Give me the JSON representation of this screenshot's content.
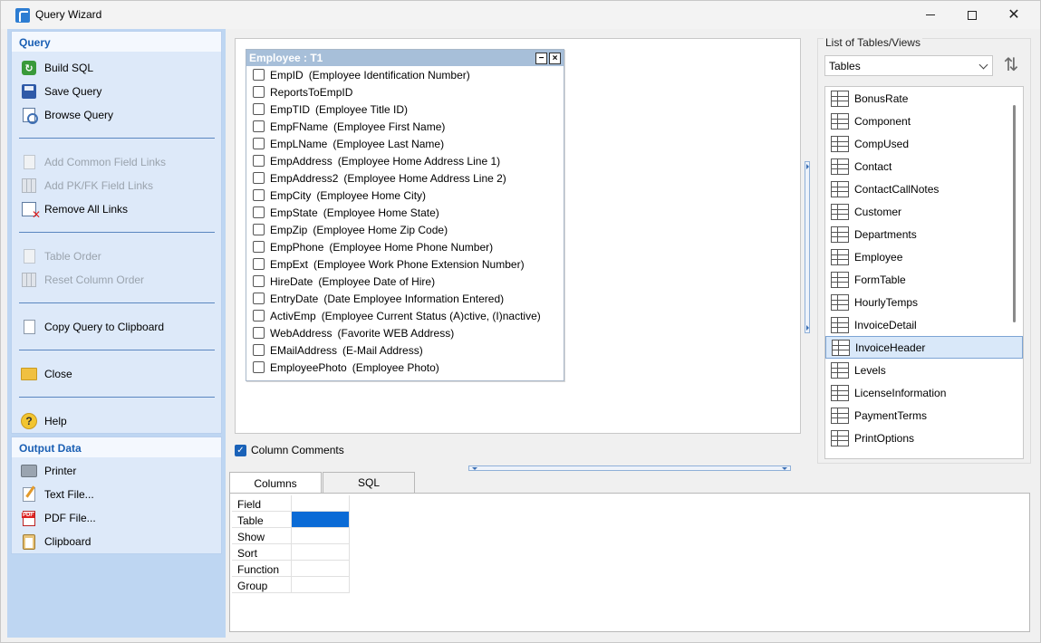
{
  "window": {
    "title": "Query Wizard",
    "minimize_glyph": "—",
    "maximize_glyph": "□",
    "close_glyph": "✕"
  },
  "left_panel": {
    "query_group": {
      "header": "Query",
      "items": [
        {
          "label": "Build SQL",
          "icon": "build-sql-icon",
          "enabled": true
        },
        {
          "label": "Save Query",
          "icon": "save-disk-icon",
          "enabled": true
        },
        {
          "label": "Browse Query",
          "icon": "browse-magnifier-icon",
          "enabled": true
        },
        {
          "label": "Add Common Field Links",
          "icon": "field-links-icon",
          "enabled": false
        },
        {
          "label": "Add PK/FK Field Links",
          "icon": "pk-fk-links-icon",
          "enabled": false
        },
        {
          "label": "Remove All Links",
          "icon": "remove-links-icon",
          "enabled": true
        },
        {
          "label": "Table Order",
          "icon": "table-order-icon",
          "enabled": false
        },
        {
          "label": "Reset Column Order",
          "icon": "reset-columns-icon",
          "enabled": false
        },
        {
          "label": "Copy Query to Clipboard",
          "icon": "copy-doc-icon",
          "enabled": true
        },
        {
          "label": "Close",
          "icon": "folder-icon",
          "enabled": true
        },
        {
          "label": "Help",
          "icon": "help-icon",
          "enabled": true
        }
      ]
    },
    "output_group": {
      "header": "Output Data",
      "items": [
        {
          "label": "Printer",
          "icon": "printer-icon"
        },
        {
          "label": "Text File...",
          "icon": "text-file-icon"
        },
        {
          "label": "PDF File...",
          "icon": "pdf-icon"
        },
        {
          "label": "Clipboard",
          "icon": "clipboard-icon"
        }
      ]
    }
  },
  "table_box": {
    "title": "Employee : T1",
    "minimize_glyph": "−",
    "close_glyph": "×",
    "fields": [
      {
        "name": "EmpID",
        "desc": "(Employee Identification Number)"
      },
      {
        "name": "ReportsToEmpID",
        "desc": ""
      },
      {
        "name": "EmpTID",
        "desc": "(Employee Title ID)"
      },
      {
        "name": "EmpFName",
        "desc": "(Employee First Name)"
      },
      {
        "name": "EmpLName",
        "desc": "(Employee Last Name)"
      },
      {
        "name": "EmpAddress",
        "desc": "(Employee Home Address Line 1)"
      },
      {
        "name": "EmpAddress2",
        "desc": "(Employee Home Address Line 2)"
      },
      {
        "name": "EmpCity",
        "desc": "(Employee Home City)"
      },
      {
        "name": "EmpState",
        "desc": "(Employee Home State)"
      },
      {
        "name": "EmpZip",
        "desc": "(Employee Home Zip Code)"
      },
      {
        "name": "EmpPhone",
        "desc": "(Employee Home Phone Number)"
      },
      {
        "name": "EmpExt",
        "desc": "(Employee Work Phone Extension Number)"
      },
      {
        "name": "HireDate",
        "desc": "(Employee Date of Hire)"
      },
      {
        "name": "EntryDate",
        "desc": "(Date Employee Information Entered)"
      },
      {
        "name": "ActivEmp",
        "desc": "(Employee Current Status (A)ctive, (I)nactive)"
      },
      {
        "name": "WebAddress",
        "desc": "(Favorite WEB Address)"
      },
      {
        "name": "EMailAddress",
        "desc": "(E-Mail Address)"
      },
      {
        "name": "EmployeePhoto",
        "desc": "(Employee Photo)"
      }
    ]
  },
  "column_comments": {
    "label": "Column Comments",
    "checked": true,
    "check_glyph": "✓"
  },
  "right_panel": {
    "label": "List of Tables/Views",
    "select_value": "Tables",
    "sort_glyph": "⇅",
    "selected_table": "InvoiceHeader",
    "tables": [
      "BonusRate",
      "Component",
      "CompUsed",
      "Contact",
      "ContactCallNotes",
      "Customer",
      "Departments",
      "Employee",
      "FormTable",
      "HourlyTemps",
      "InvoiceDetail",
      "InvoiceHeader",
      "Levels",
      "LicenseInformation",
      "PaymentTerms",
      "PrintOptions"
    ]
  },
  "bottom": {
    "tabs": [
      {
        "label": "Columns",
        "active": true
      },
      {
        "label": "SQL",
        "active": false
      }
    ],
    "grid_rows": [
      "Field",
      "Table",
      "Show",
      "Sort",
      "Function",
      "Group"
    ],
    "selected_cell": {
      "row": "Table",
      "column": 0
    },
    "selection_color": "#0a6bd6"
  },
  "colors": {
    "left_panel_bg": "#bed6f2",
    "group_bg": "#dde9f9",
    "group_header_text": "#1a5fb4",
    "table_title_bg": "#a7bfd9",
    "selected_item_bg": "#d9e8f9"
  }
}
